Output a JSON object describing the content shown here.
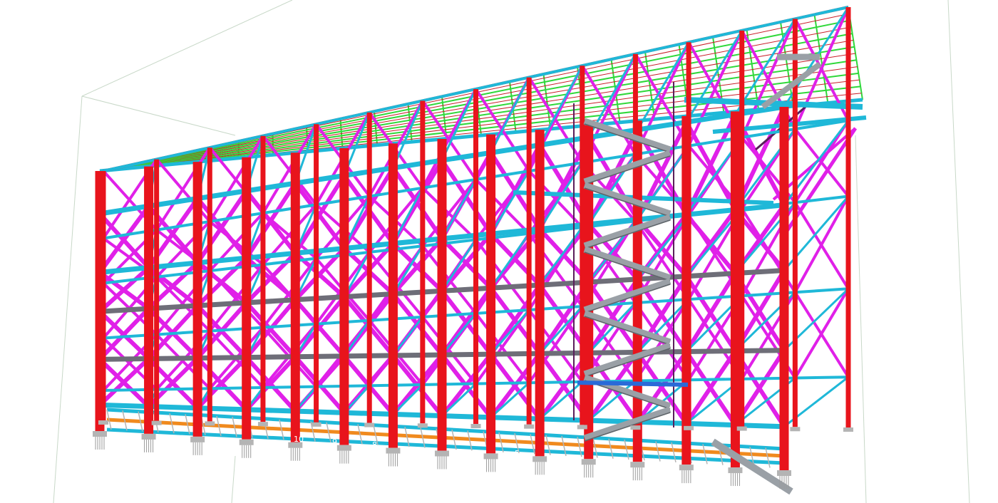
{
  "view": {
    "background": "#ffffff",
    "grid_labels": [
      "10",
      "9",
      "8",
      "5"
    ]
  },
  "colors": {
    "column": "#e8141c",
    "brace": "#e020e8",
    "beam_cyan": "#1fb8d8",
    "beam_gray": "#6e6e78",
    "roof_green": "#2fd83a",
    "roof_purlin": "#c81e28",
    "stair": "#9aa0a6",
    "platform_orange": "#f08a1e",
    "base_plate": "#b4b4b4",
    "bounding_box": "#c8d8c8",
    "dark_strut": "#5a1e5a"
  }
}
